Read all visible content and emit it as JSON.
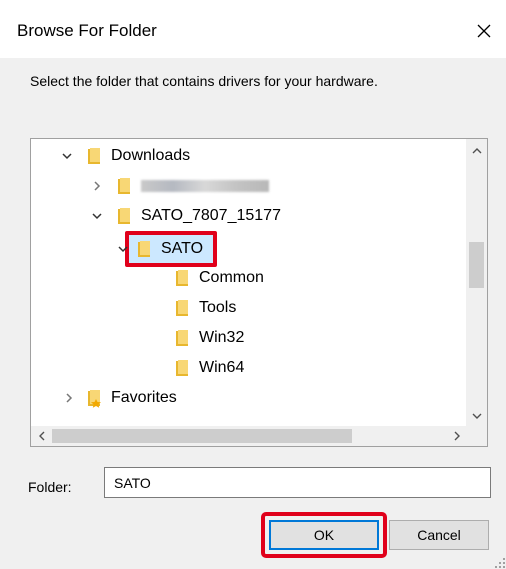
{
  "dialog": {
    "title": "Browse For Folder",
    "instruction": "Select the folder that contains drivers for your hardware.",
    "tree": {
      "items": [
        {
          "label": "Downloads"
        },
        {
          "label": ""
        },
        {
          "label": "SATO_7807_15177"
        },
        {
          "label": "SATO",
          "selected": true
        },
        {
          "label": "Common"
        },
        {
          "label": "Tools"
        },
        {
          "label": "Win32"
        },
        {
          "label": "Win64"
        },
        {
          "label": "Favorites"
        }
      ]
    },
    "folder_label": "Folder:",
    "folder_value": "SATO",
    "ok_label": "OK",
    "cancel_label": "Cancel"
  },
  "colors": {
    "folder": "#dcb33a",
    "selection": "#cce8ff",
    "highlight": "#e0001b",
    "focus": "#0078d7"
  }
}
